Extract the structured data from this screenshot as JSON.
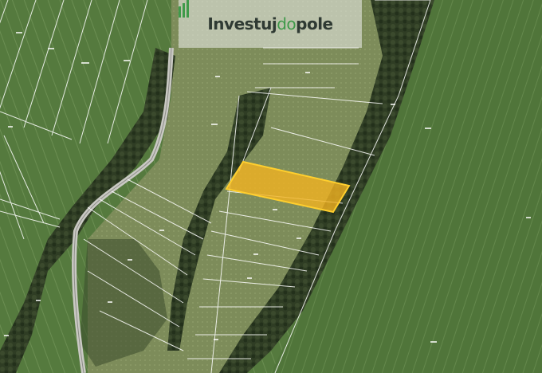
{
  "brand": {
    "part1": "Investuj",
    "part2": "do",
    "part3": "pole"
  },
  "colors": {
    "field": "#55793d",
    "meadow": "#7f8f5c",
    "trees": "#2c3a22",
    "road": "#c9c9c3",
    "parcel_lines": "#ffffff",
    "highlight_fill": "#f2b320",
    "highlight_stroke": "#ffcf2e"
  },
  "map": {
    "highlighted_parcel": true
  }
}
